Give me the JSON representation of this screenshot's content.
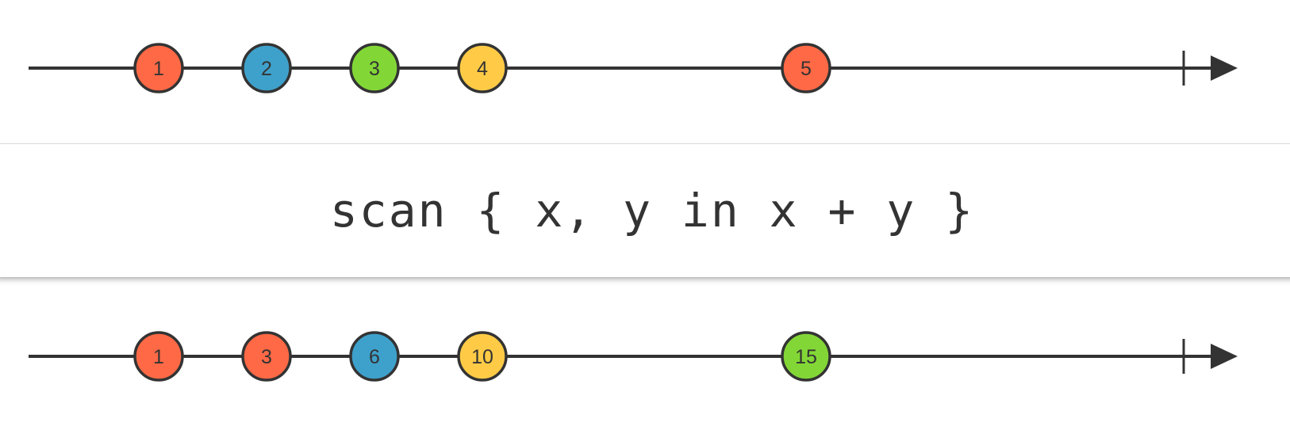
{
  "diagram": {
    "operator": {
      "label": "scan { x, y in x + y }"
    },
    "colors": {
      "red": "#ff6946",
      "blue": "#3ea1cb",
      "green": "#82d736",
      "yellow": "#ffcb46",
      "line": "#333333"
    },
    "input": {
      "marbles": [
        {
          "t": 1,
          "label": "1",
          "color": "red"
        },
        {
          "t": 2,
          "label": "2",
          "color": "blue"
        },
        {
          "t": 3,
          "label": "3",
          "color": "green"
        },
        {
          "t": 4,
          "label": "4",
          "color": "yellow"
        },
        {
          "t": 7,
          "label": "5",
          "color": "red"
        }
      ],
      "completes": true
    },
    "output": {
      "marbles": [
        {
          "t": 1,
          "label": "1",
          "color": "red"
        },
        {
          "t": 2,
          "label": "3",
          "color": "red"
        },
        {
          "t": 3,
          "label": "6",
          "color": "blue"
        },
        {
          "t": 4,
          "label": "10",
          "color": "yellow"
        },
        {
          "t": 7,
          "label": "15",
          "color": "green"
        }
      ],
      "completes": true
    }
  }
}
